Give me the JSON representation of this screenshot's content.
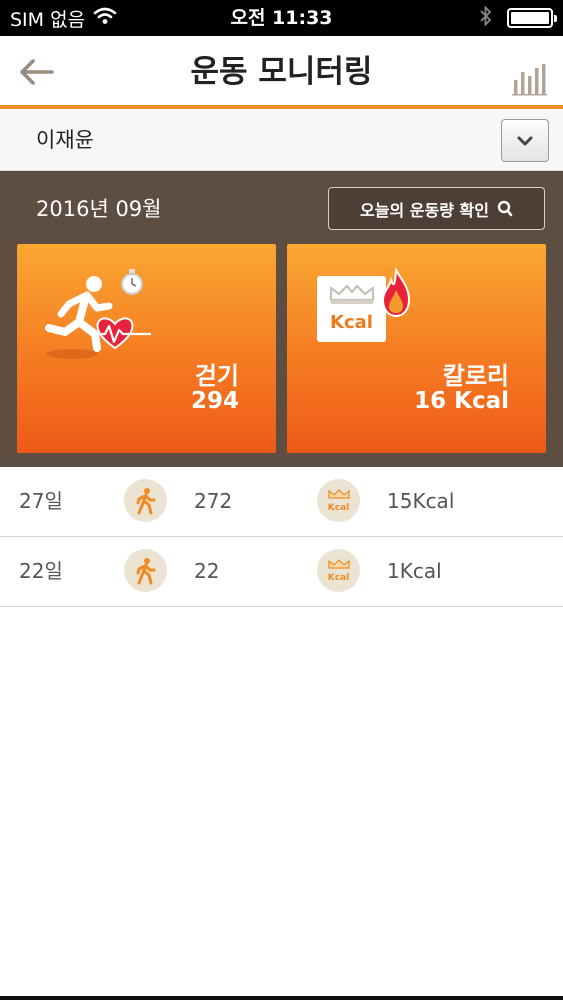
{
  "status_bar": {
    "carrier": "SIM 없음",
    "time": "오전 11:33"
  },
  "nav": {
    "title": "운동 모니터링",
    "back_icon": "arrow-left-icon",
    "chart_icon": "bar-chart-icon"
  },
  "member": {
    "name": "이재윤"
  },
  "summary": {
    "month": "2016년 09월",
    "today_button": "오늘의 운동량 확인",
    "walk": {
      "label": "걷기",
      "value": "294"
    },
    "calorie": {
      "label": "칼로리",
      "value": "16 Kcal",
      "badge": "Kcal"
    }
  },
  "records": [
    {
      "day": "27일",
      "steps": "272",
      "kcal": "15Kcal",
      "badge": "Kcal"
    },
    {
      "day": "22일",
      "steps": "22",
      "kcal": "1Kcal",
      "badge": "Kcal"
    }
  ],
  "colors": {
    "accent": "#f08a24",
    "panel": "#5e4d41",
    "card_top": "#f9a732",
    "card_bottom": "#ee5a18"
  }
}
